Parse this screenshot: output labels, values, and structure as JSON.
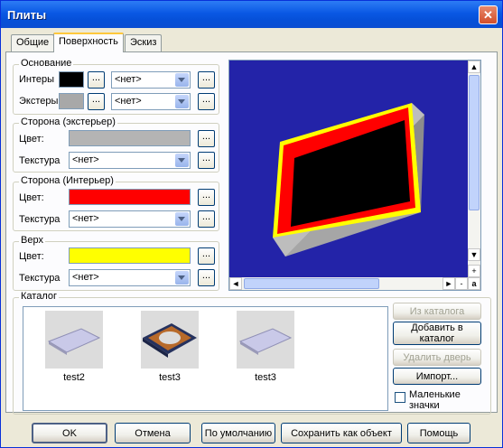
{
  "window": {
    "title": "Плиты",
    "close_icon": "close-icon"
  },
  "tabs": [
    {
      "label": "Общие",
      "active": false
    },
    {
      "label": "Поверхность",
      "active": true
    },
    {
      "label": "Эскиз",
      "active": false
    }
  ],
  "base": {
    "legend": "Основание",
    "interior": {
      "label": "Интеры",
      "color": "#000000",
      "button": "...",
      "select": "<нет>",
      "button2": "..."
    },
    "exterior": {
      "label": "Экстеры",
      "color": "#a8a8a8",
      "button": "...",
      "select": "<нет>",
      "button2": "..."
    }
  },
  "side_exterior": {
    "legend": "Сторона (экстерьер)",
    "color_label": "Цвет:",
    "color": "#b4b4b4",
    "color_button": "...",
    "texture_label": "Текстура",
    "texture": "<нет>",
    "texture_button": "..."
  },
  "side_interior": {
    "legend": "Сторона (Интерьер)",
    "color_label": "Цвет:",
    "color": "#ff0000",
    "color_button": "...",
    "texture_label": "Текстура",
    "texture": "<нет>",
    "texture_button": "..."
  },
  "top": {
    "legend": "Верх",
    "color_label": "Цвет:",
    "color": "#ffff00",
    "color_button": "...",
    "texture_label": "Текстура",
    "texture": "<нет>",
    "texture_button": "..."
  },
  "preview": {
    "background": "#2323a8",
    "zoom_in": "+",
    "zoom_out": "-",
    "auto": "a",
    "scroll_up": "▲",
    "scroll_down": "▼",
    "scroll_left": "◄",
    "scroll_right": "►"
  },
  "catalog": {
    "legend": "Каталог",
    "items": [
      {
        "label": "test2",
        "icon": "flat-plate-thumbnail-icon"
      },
      {
        "label": "test3",
        "icon": "frame-plate-thumbnail-icon"
      },
      {
        "label": "test3",
        "icon": "flat-plate-thumbnail-icon"
      }
    ],
    "from_catalog": "Из каталога",
    "add_to_catalog": "Добавить в каталог",
    "delete_door": "Удалить дверь",
    "import": "Импорт...",
    "small_icons": "Маленькие значки",
    "small_icons_checked": false
  },
  "footer": {
    "ok": "OK",
    "cancel": "Отмена",
    "default": "По умолчанию",
    "save_as_object": "Сохранить как объект",
    "help": "Помощь"
  }
}
